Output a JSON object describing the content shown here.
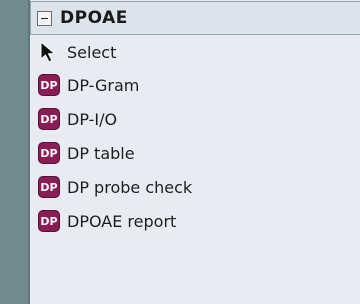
{
  "section": {
    "title": "DPOAE",
    "collapse_icon": "minus-box-icon"
  },
  "items": [
    {
      "label": "Select",
      "icon": "cursor-arrow-icon"
    },
    {
      "label": "DP-Gram",
      "icon_text": "DP"
    },
    {
      "label": "DP-I/O",
      "icon_text": "DP"
    },
    {
      "label": "DP table",
      "icon_text": "DP"
    },
    {
      "label": "DP probe check",
      "icon_text": "DP"
    },
    {
      "label": "DPOAE report",
      "icon_text": "DP"
    }
  ],
  "colors": {
    "background": "#708a8e",
    "panel": "#e8ecf2",
    "dp_icon": "#8a1d55"
  }
}
